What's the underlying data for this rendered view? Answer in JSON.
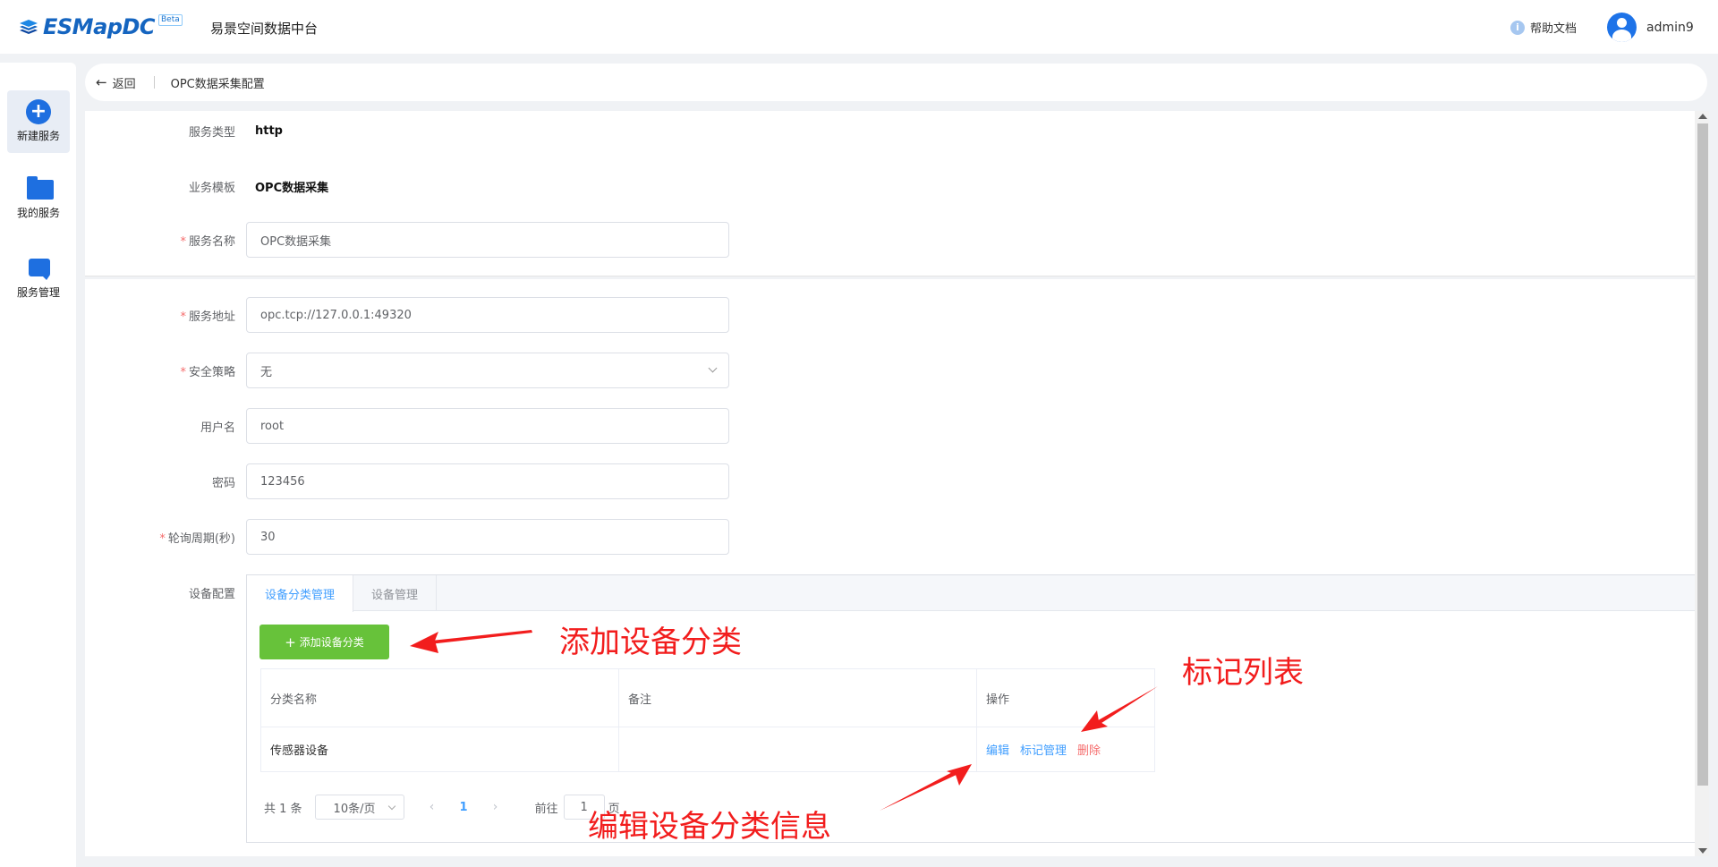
{
  "header": {
    "logo_text": "ESMapDC",
    "beta_badge": "Beta",
    "app_name": "易景空间数据中台",
    "help_label": "帮助文档",
    "username": "admin9"
  },
  "sidebar": {
    "items": [
      {
        "label": "新建服务",
        "icon": "plus-circle-icon",
        "active": true
      },
      {
        "label": "我的服务",
        "icon": "folder-icon",
        "active": false
      },
      {
        "label": "服务管理",
        "icon": "chat-icon",
        "active": false
      }
    ]
  },
  "breadcrumb": {
    "back_label": "返回",
    "title": "OPC数据采集配置"
  },
  "form": {
    "service_type": {
      "label": "服务类型",
      "value": "http"
    },
    "biz_template": {
      "label": "业务模板",
      "value": "OPC数据采集"
    },
    "service_name": {
      "label": "服务名称",
      "value": "OPC数据采集",
      "required": true
    },
    "service_address": {
      "label": "服务地址",
      "value": "opc.tcp://127.0.0.1:49320",
      "required": true
    },
    "security_policy": {
      "label": "安全策略",
      "value": "无",
      "required": true
    },
    "username": {
      "label": "用户名",
      "value": "root"
    },
    "password": {
      "label": "密码",
      "value": "123456"
    },
    "poll_period": {
      "label": "轮询周期(秒)",
      "value": "30",
      "required": true
    },
    "device_config": {
      "label": "设备配置"
    }
  },
  "device_tabs": {
    "tabs": [
      "设备分类管理",
      "设备管理"
    ],
    "active_tab": 0,
    "add_button": "添加设备分类",
    "table": {
      "columns": [
        "分类名称",
        "备注",
        "操作"
      ],
      "rows": [
        {
          "name": "传感器设备",
          "remark": "",
          "actions": [
            "编辑",
            "标记管理",
            "删除"
          ]
        }
      ]
    },
    "pagination": {
      "total": "共 1 条",
      "page_size": "10条/页",
      "prev": "‹",
      "current_page": "1",
      "next": "›",
      "goto_label": "前往",
      "goto_value": "1",
      "page_suffix": "页"
    }
  },
  "annotations": {
    "add_category": "添加设备分类",
    "tag_list": "标记列表",
    "edit_info": "编辑设备分类信息"
  },
  "colors": {
    "primary": "#409eff",
    "success": "#67c23a",
    "danger": "#f56c6c",
    "annotation": "#f21d1d",
    "brand": "#1e6fe0"
  }
}
